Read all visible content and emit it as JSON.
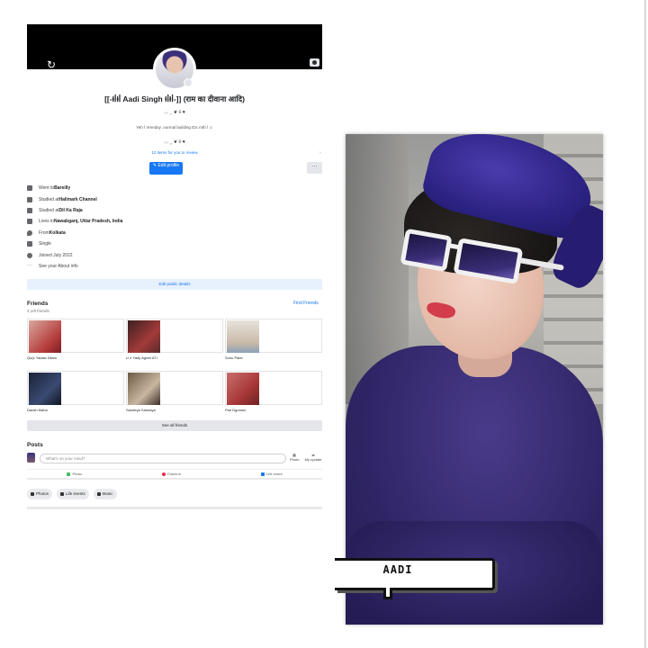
{
  "profile": {
    "name": "[[-ƗꟾƗꟾ Aadi Singh ƗꟾƗꟾ-]] (राम का दीवाना आदि)",
    "bio_line_1": "⸝⸝ ‿ ❦ ⍟ ♥",
    "bio_text": "Yeh l Vrenday ,normal building IDc mth l ☺",
    "bio_line_2": "⸝⸝ ‿ ❦ ⍟ ♥",
    "items_link": "12 items for you to review",
    "edit_profile_label": "✎ Edit profile",
    "more_label": "···",
    "details": [
      {
        "icon": "education-icon",
        "prefix": "Went to ",
        "bold": "Bareilly"
      },
      {
        "icon": "education-icon",
        "prefix": "Studied at ",
        "bold": "Hallmark Channel"
      },
      {
        "icon": "education-icon",
        "prefix": "Studied at ",
        "bold": "Dil Ka Raja"
      },
      {
        "icon": "home-icon",
        "prefix": "Lives in ",
        "bold": "Nawabganj, Uttar Pradesh, India"
      },
      {
        "icon": "location-icon",
        "prefix": "From ",
        "bold": "Kolkata"
      },
      {
        "icon": "heart-icon",
        "prefix": "Single",
        "bold": ""
      },
      {
        "icon": "clock-icon",
        "prefix": "Joined July 2022",
        "bold": ""
      },
      {
        "icon": "more-icon",
        "prefix": "See your About info",
        "bold": ""
      }
    ],
    "edit_public_details": "Edit public details",
    "friends": {
      "title": "Friends",
      "count": "2,1/9 friends",
      "find_label": "Find Friends",
      "list": [
        {
          "name": "Qu(s Yadaw Dilam"
        },
        {
          "name": "Li e Yady Agrah ATI"
        },
        {
          "name": "Sonu Patel"
        },
        {
          "name": "Dansh Maha"
        },
        {
          "name": "Sandeya Sannaya"
        },
        {
          "name": "Pari Dgumon"
        }
      ],
      "see_all": "See all friends"
    },
    "posts": {
      "title": "Posts",
      "placeholder": "What's on your mind?",
      "photo_label": "Photo",
      "update_label": "My update",
      "actions": [
        "Photo",
        "Check in",
        "Life event"
      ],
      "chips": [
        "Photos",
        "Life events",
        "Music"
      ]
    }
  },
  "photo_caption": "AADI",
  "colors": {
    "facebook_blue": "#1877f2",
    "cap_purple": "#2d2384",
    "shirt_purple": "#2f2566"
  }
}
